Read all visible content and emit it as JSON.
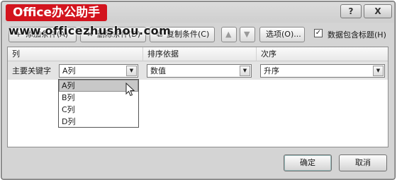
{
  "brand": "Office办公助手",
  "watermark": "www.officezhushou.com",
  "title_buttons": {
    "help": "?",
    "close": "X"
  },
  "toolbar": {
    "add_icon": "+",
    "add_label": "添加条件(A)",
    "delete_icon": "✕",
    "delete_label": "删除条件(D)",
    "copy_icon": "⧉",
    "copy_label": "复制条件(C)",
    "up_icon": "▲",
    "down_icon": "▼",
    "options_label": "选项(O)...",
    "header_checkbox_mark": "✓",
    "header_checkbox_label": "数据包含标题(H)"
  },
  "grid": {
    "columns": [
      "列",
      "排序依据",
      "次序"
    ],
    "row": {
      "label": "主要关键字",
      "key_value": "A列",
      "basis_value": "数值",
      "order_value": "升序"
    }
  },
  "dropdown": {
    "options": [
      "A列",
      "B列",
      "C列",
      "D列"
    ],
    "highlighted": "A列"
  },
  "buttons": {
    "ok": "确定",
    "cancel": "取消"
  }
}
